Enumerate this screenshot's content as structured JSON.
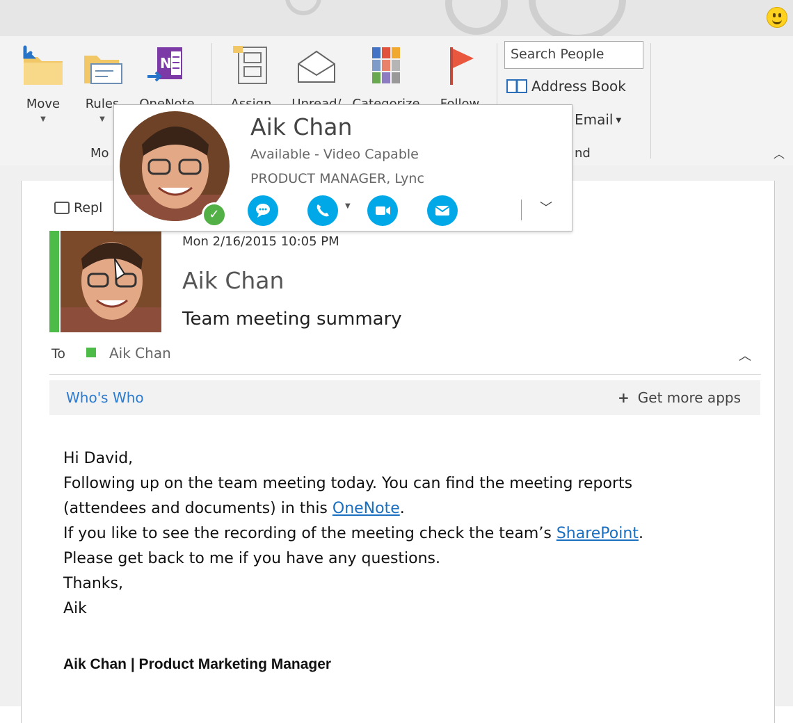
{
  "ribbon": {
    "move": {
      "label": "Move"
    },
    "rules": {
      "label": "Rules"
    },
    "onenote": {
      "label": "OneNote"
    },
    "assign": {
      "label": "Assign"
    },
    "unread": {
      "label": "Unread/"
    },
    "categorize": {
      "label": "Categorize"
    },
    "follow": {
      "label": "Follow"
    },
    "move_group_label": "Mo",
    "search_people_placeholder": "Search People",
    "address_book_label": "Address Book",
    "filter_email_label": "Email",
    "find_group_label": "nd"
  },
  "contact_card": {
    "name": "Aik Chan",
    "status": "Available - Video Capable",
    "title": "PRODUCT MANAGER, Lync",
    "presence_color": "#52b046",
    "action_color": "#00a8e8"
  },
  "message": {
    "reply_label": "Repl",
    "date": "Mon 2/16/2015 10:05 PM",
    "sender": "Aik Chan",
    "subject": "Team meeting summary",
    "to_label": "To",
    "to_name": "Aik Chan",
    "presence_color": "#4dbb48",
    "apps": {
      "whos_who": "Who's Who",
      "get_more_apps": "Get more apps"
    },
    "body": {
      "greeting": "Hi David,",
      "line1": "Following up on the team meeting today. You can find the meeting reports",
      "line2_pre": "(attendees and documents) in this ",
      "onenote_link": "OneNote",
      "line2_post": ".",
      "line3_pre": "If you like to see the recording of the meeting check the team’s ",
      "sharepoint_link": "SharePoint",
      "line3_post": ".",
      "line4": "Please get back to me if you have any questions.",
      "line5": "Thanks,",
      "line6": "Aik"
    },
    "signature": "Aik Chan | Product Marketing Manager"
  }
}
